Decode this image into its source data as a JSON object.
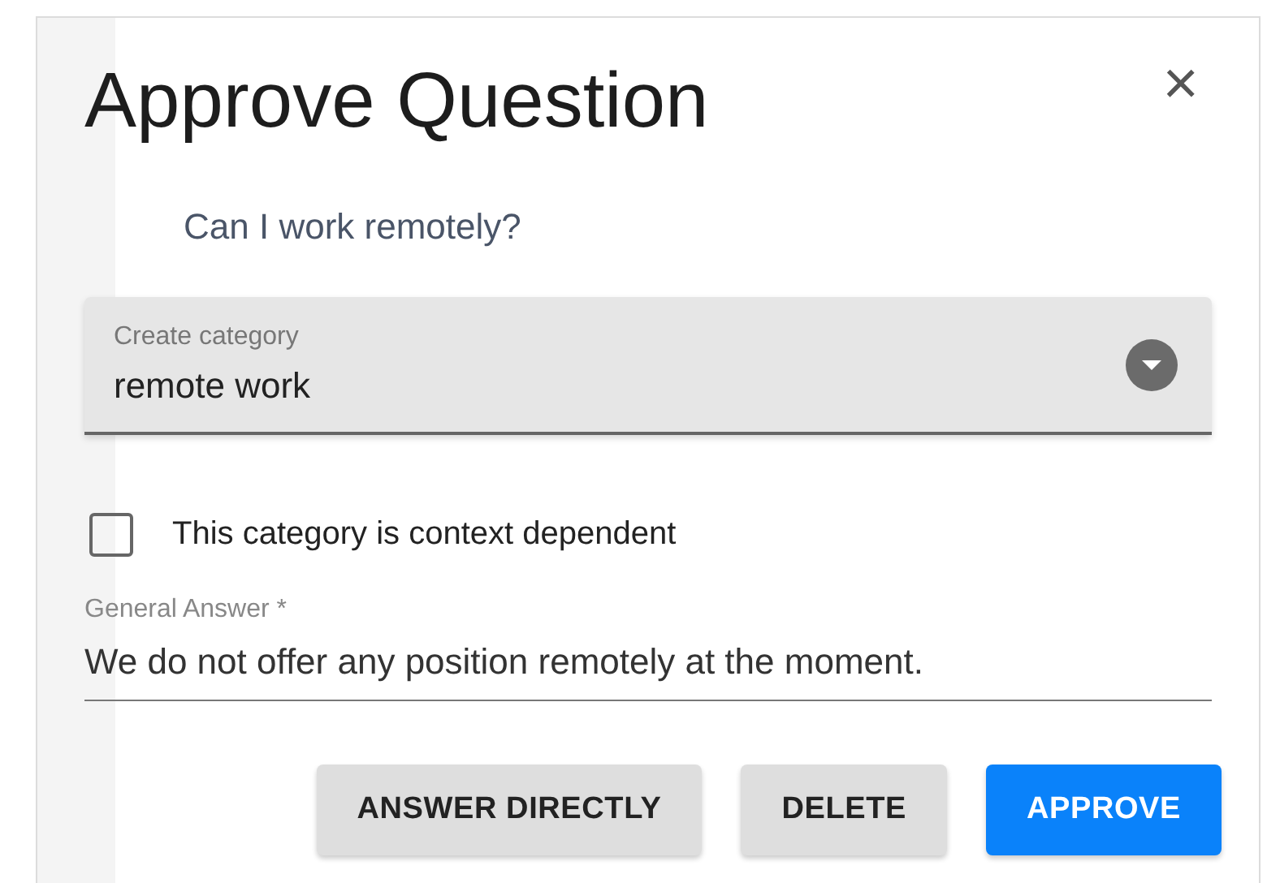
{
  "dialog": {
    "title": "Approve Question",
    "close": "×",
    "question": "Can I work remotely?"
  },
  "category_select": {
    "label": "Create category",
    "value": "remote work"
  },
  "context_checkbox": {
    "label": "This category is context dependent",
    "checked": false
  },
  "answer_field": {
    "label": "General Answer *",
    "value": "We do not offer any position remotely at the moment."
  },
  "buttons": [
    {
      "label": "ANSWER DIRECTLY",
      "kind": "secondary"
    },
    {
      "label": "DELETE",
      "kind": "secondary"
    },
    {
      "label": "APPROVE",
      "kind": "primary"
    }
  ]
}
